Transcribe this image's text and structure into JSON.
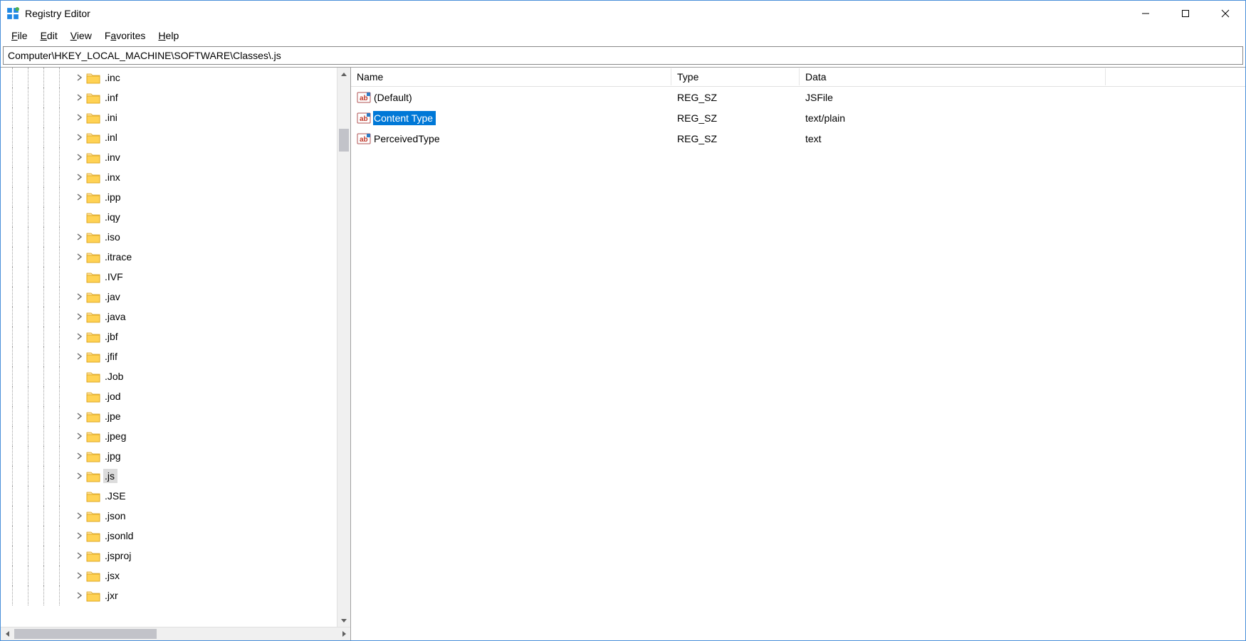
{
  "window": {
    "title": "Registry Editor"
  },
  "menu": {
    "file": "File",
    "edit": "Edit",
    "view": "View",
    "favorites": "Favorites",
    "help": "Help"
  },
  "address": "Computer\\HKEY_LOCAL_MACHINE\\SOFTWARE\\Classes\\.js",
  "tree": {
    "items": [
      {
        "label": ".inc",
        "expandable": true
      },
      {
        "label": ".inf",
        "expandable": true
      },
      {
        "label": ".ini",
        "expandable": true
      },
      {
        "label": ".inl",
        "expandable": true
      },
      {
        "label": ".inv",
        "expandable": true
      },
      {
        "label": ".inx",
        "expandable": true
      },
      {
        "label": ".ipp",
        "expandable": true
      },
      {
        "label": ".iqy",
        "expandable": false
      },
      {
        "label": ".iso",
        "expandable": true
      },
      {
        "label": ".itrace",
        "expandable": true
      },
      {
        "label": ".IVF",
        "expandable": false
      },
      {
        "label": ".jav",
        "expandable": true
      },
      {
        "label": ".java",
        "expandable": true
      },
      {
        "label": ".jbf",
        "expandable": true
      },
      {
        "label": ".jfif",
        "expandable": true
      },
      {
        "label": ".Job",
        "expandable": false
      },
      {
        "label": ".jod",
        "expandable": false
      },
      {
        "label": ".jpe",
        "expandable": true
      },
      {
        "label": ".jpeg",
        "expandable": true
      },
      {
        "label": ".jpg",
        "expandable": true
      },
      {
        "label": ".js",
        "expandable": true,
        "selected": true
      },
      {
        "label": ".JSE",
        "expandable": false
      },
      {
        "label": ".json",
        "expandable": true
      },
      {
        "label": ".jsonld",
        "expandable": true
      },
      {
        "label": ".jsproj",
        "expandable": true
      },
      {
        "label": ".jsx",
        "expandable": true
      },
      {
        "label": ".jxr",
        "expandable": true
      }
    ]
  },
  "list": {
    "headers": {
      "name": "Name",
      "type": "Type",
      "data": "Data"
    },
    "rows": [
      {
        "name": "(Default)",
        "type": "REG_SZ",
        "data": "JSFile",
        "selected": false
      },
      {
        "name": "Content Type",
        "type": "REG_SZ",
        "data": "text/plain",
        "selected": true
      },
      {
        "name": "PerceivedType",
        "type": "REG_SZ",
        "data": "text",
        "selected": false
      }
    ]
  }
}
